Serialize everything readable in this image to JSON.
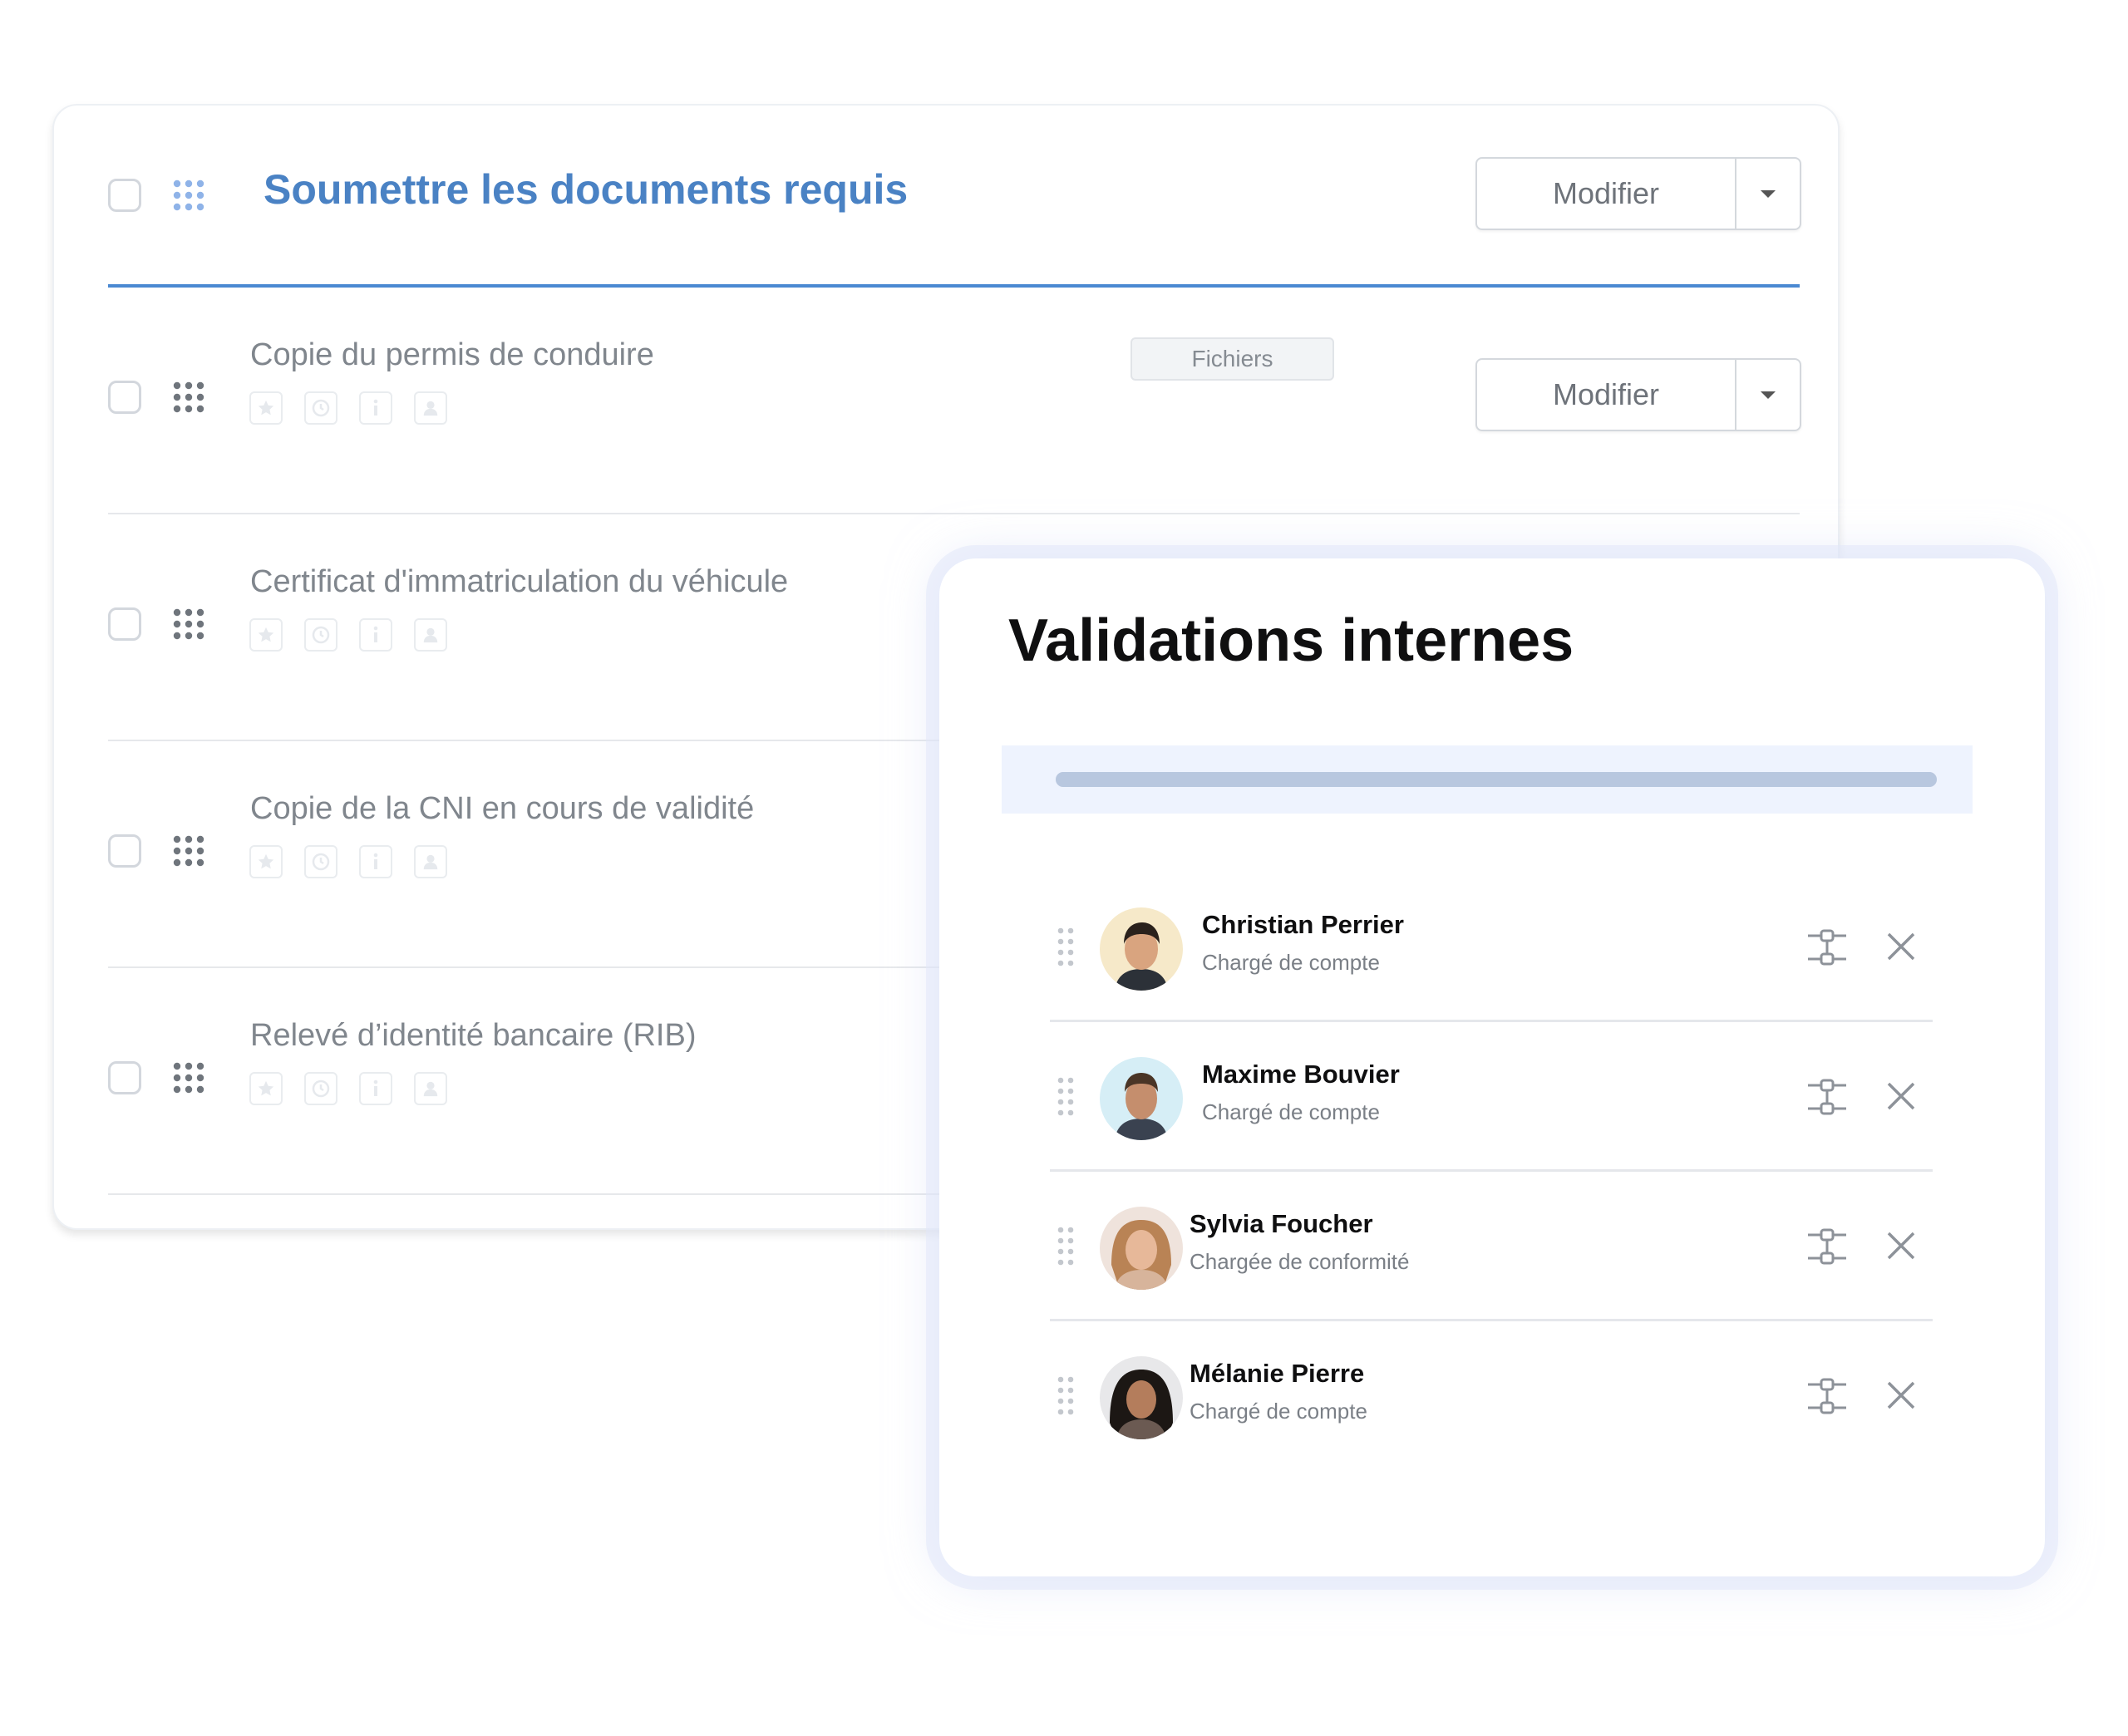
{
  "section": {
    "title": "Soumettre les documents requis",
    "modify_label": "Modifier"
  },
  "tasks": [
    {
      "title": "Copie du permis de conduire",
      "badge": "Fichiers",
      "modify_label": "Modifier"
    },
    {
      "title": "Certificat d'immatriculation du véhicule"
    },
    {
      "title": "Copie de la CNI en cours de validité"
    },
    {
      "title": "Relevé d’identité bancaire (RIB)"
    }
  ],
  "task_icons": [
    "star-icon",
    "clock-icon",
    "info-icon",
    "user-icon"
  ],
  "validations": {
    "title": "Validations internes",
    "progress": 1.0,
    "people": [
      {
        "name": "Christian Perrier",
        "role": "Chargé de compte"
      },
      {
        "name": "Maxime Bouvier",
        "role": "Chargé de compte"
      },
      {
        "name": "Sylvia Foucher",
        "role": "Chargée de conformité"
      },
      {
        "name": "Mélanie Pierre",
        "role": "Chargé de compte"
      }
    ]
  },
  "colors": {
    "accent": "#4a82c4",
    "accent_line": "#4a89d2",
    "progress_band": "#eef3fe",
    "progress_fill": "#b8c7df"
  }
}
